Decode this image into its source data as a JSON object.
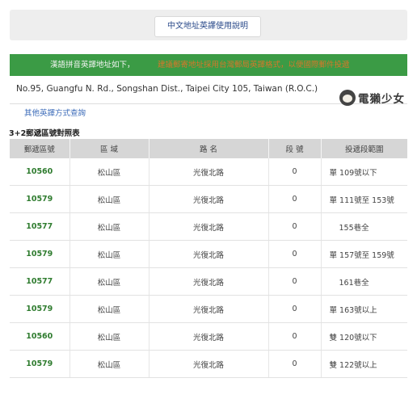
{
  "header": {
    "help_button": "中文地址英譯使用說明"
  },
  "result": {
    "prefix": "漢語拼音英譯地址如下，",
    "notice": "建議郵寄地址採用台灣郵局英譯格式，以便國際郵件投遞",
    "address": "No.95, Guangfu N. Rd., Songshan Dist., Taipei City 105, Taiwan (R.O.C.)",
    "other_link": "其他英譯方式查詢"
  },
  "logo": {
    "text": "電獺少女"
  },
  "table": {
    "title": "3+2郵遞區號對照表",
    "headers": [
      "郵遞區號",
      "區 域",
      "路 名",
      "段 號",
      "投遞段範圍"
    ],
    "rows": [
      {
        "code": "10560",
        "district": "松山區",
        "road": "光復北路",
        "section": "0",
        "range": "單 109號以下"
      },
      {
        "code": "10579",
        "district": "松山區",
        "road": "光復北路",
        "section": "0",
        "range": "單 111號至 153號"
      },
      {
        "code": "10577",
        "district": "松山區",
        "road": "光復北路",
        "section": "0",
        "range": "155巷全"
      },
      {
        "code": "10579",
        "district": "松山區",
        "road": "光復北路",
        "section": "0",
        "range": "單 157號至 159號"
      },
      {
        "code": "10577",
        "district": "松山區",
        "road": "光復北路",
        "section": "0",
        "range": "161巷全"
      },
      {
        "code": "10579",
        "district": "松山區",
        "road": "光復北路",
        "section": "0",
        "range": "單 163號以上"
      },
      {
        "code": "10560",
        "district": "松山區",
        "road": "光復北路",
        "section": "0",
        "range": "雙 120號以下"
      },
      {
        "code": "10579",
        "district": "松山區",
        "road": "光復北路",
        "section": "0",
        "range": "雙 122號以上"
      }
    ]
  }
}
